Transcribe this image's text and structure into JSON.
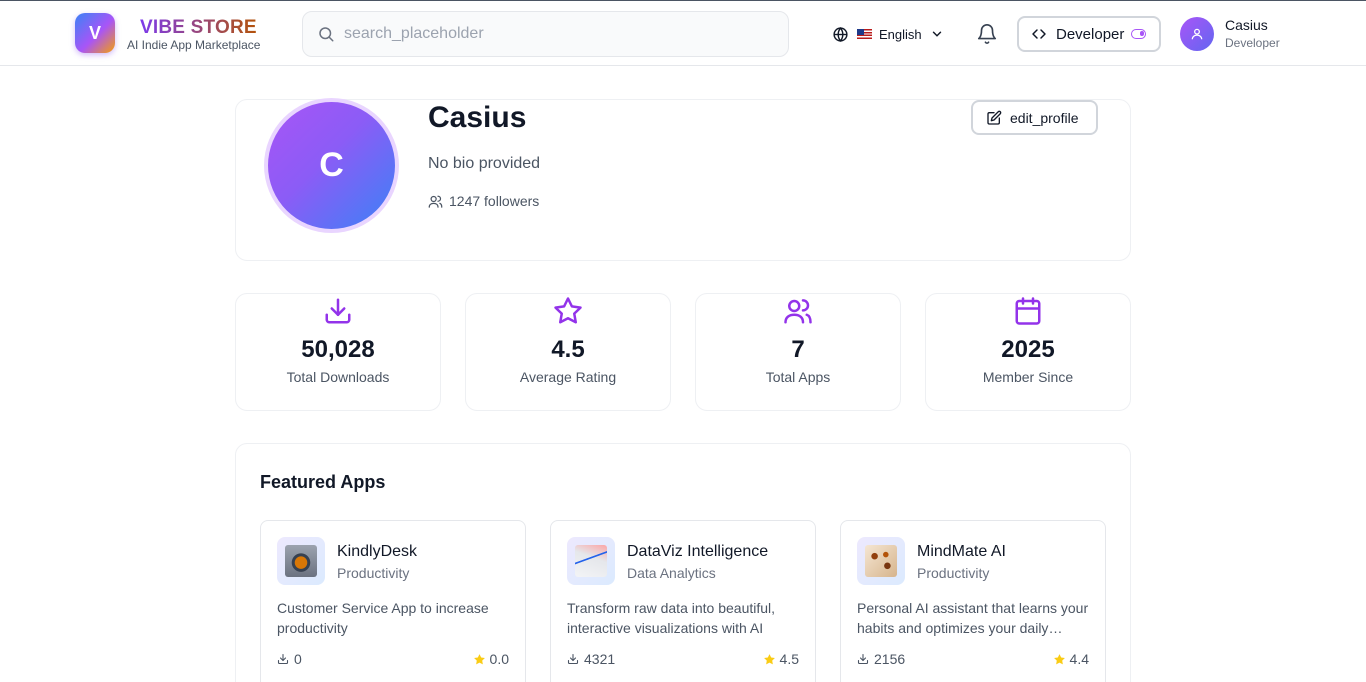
{
  "header": {
    "logo_letter": "V",
    "brand_name": "VIBE STORE",
    "brand_tagline": "AI Indie App Marketplace",
    "search_placeholder": "search_placeholder",
    "language": "English",
    "developer_label": "Developer",
    "user": {
      "name": "Casius",
      "role": "Developer"
    }
  },
  "profile": {
    "initial": "C",
    "name": "Casius",
    "bio": "No bio provided",
    "followers": "1247 followers",
    "edit_label": "edit_profile"
  },
  "stats": [
    {
      "icon": "download-icon",
      "value": "50,028",
      "label": "Total Downloads"
    },
    {
      "icon": "star-icon",
      "value": "4.5",
      "label": "Average Rating"
    },
    {
      "icon": "users-icon",
      "value": "7",
      "label": "Total Apps"
    },
    {
      "icon": "calendar-icon",
      "value": "2025",
      "label": "Member Since"
    }
  ],
  "featured": {
    "title": "Featured Apps",
    "apps": [
      {
        "name": "KindlyDesk",
        "category": "Productivity",
        "description": "Customer Service App to increase productivity",
        "downloads": "0",
        "rating": "0.0"
      },
      {
        "name": "DataViz Intelligence",
        "category": "Data Analytics",
        "description": "Transform raw data into beautiful, interactive visualizations with AI",
        "downloads": "4321",
        "rating": "4.5"
      },
      {
        "name": "MindMate AI",
        "category": "Productivity",
        "description": "Personal AI assistant that learns your habits and optimizes your daily routine",
        "downloads": "2156",
        "rating": "4.4"
      }
    ]
  },
  "colors": {
    "accent": "#9333ea",
    "star": "#facc15",
    "border": "#e5e7eb"
  }
}
